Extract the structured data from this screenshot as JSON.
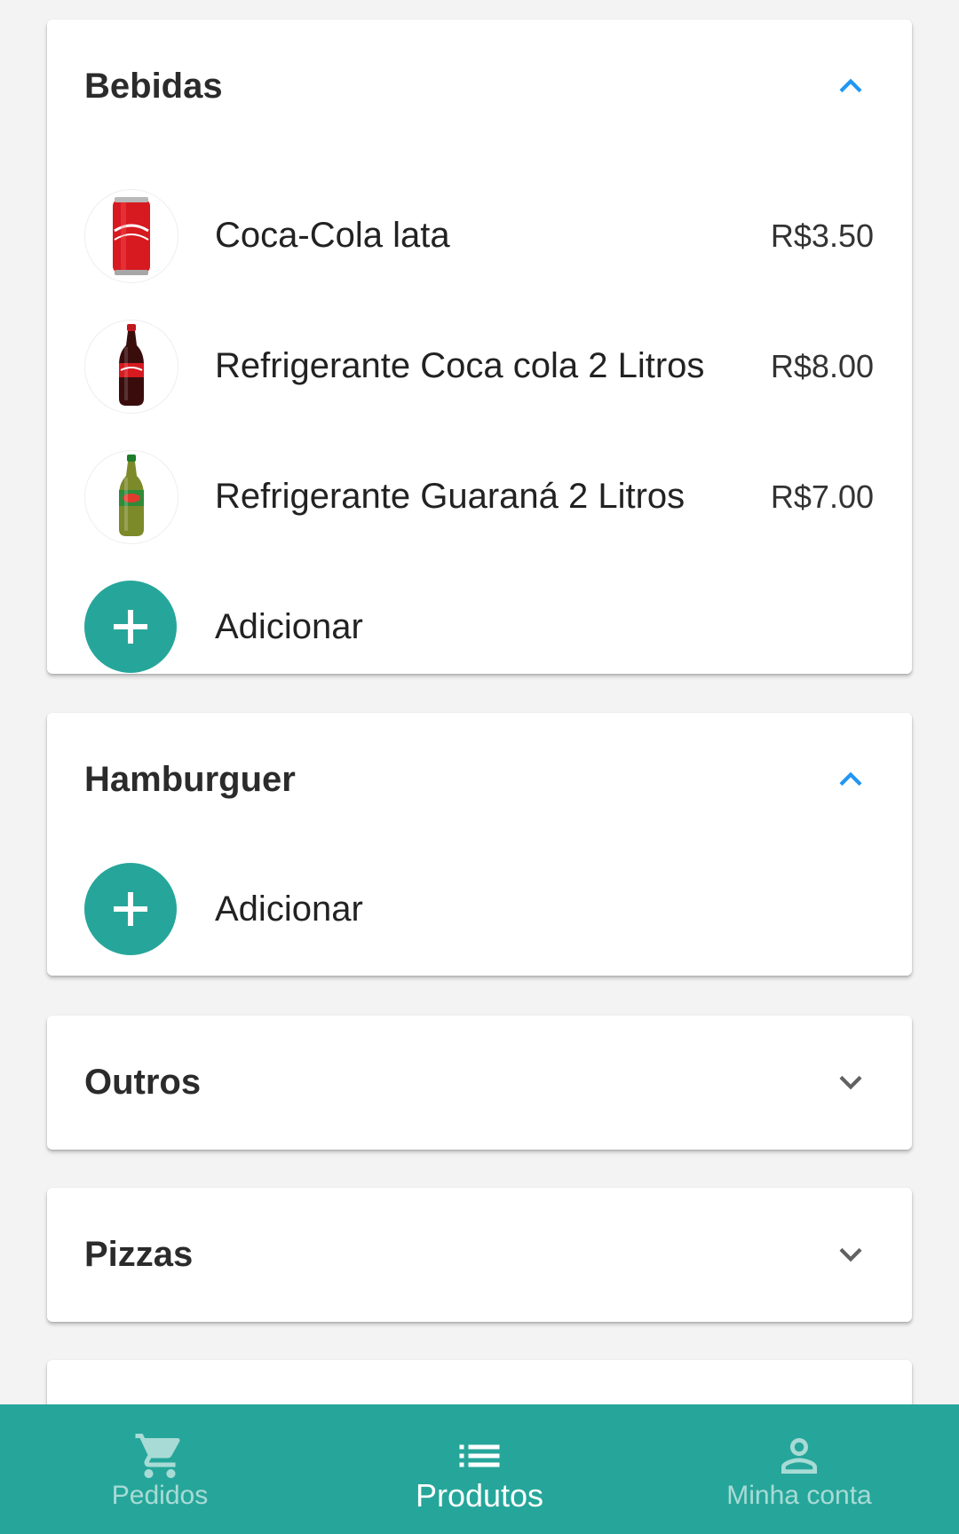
{
  "colors": {
    "accent": "#26a69a",
    "chevron_expanded": "#2196f3",
    "chevron_collapsed": "#616161",
    "background": "#f3f3f3"
  },
  "categories": [
    {
      "title": "Bebidas",
      "expanded": true,
      "chevron": "chevron-up-icon",
      "products": [
        {
          "name": "Coca-Cola lata",
          "price": "R$3.50",
          "image": "coca-cola-can"
        },
        {
          "name": "Refrigerante Coca cola 2 Litros",
          "price": "R$8.00",
          "image": "coca-cola-bottle"
        },
        {
          "name": "Refrigerante Guaraná 2 Litros",
          "price": "R$7.00",
          "image": "guarana-bottle"
        }
      ],
      "add_label": "Adicionar"
    },
    {
      "title": "Hamburguer",
      "expanded": true,
      "chevron": "chevron-up-icon",
      "products": [],
      "add_label": "Adicionar"
    },
    {
      "title": "Outros",
      "expanded": false,
      "chevron": "chevron-down-icon"
    },
    {
      "title": "Pizzas",
      "expanded": false,
      "chevron": "chevron-down-icon"
    }
  ],
  "bottom_nav": {
    "items": [
      {
        "label": "Pedidos",
        "icon": "cart-icon",
        "active": false
      },
      {
        "label": "Produtos",
        "icon": "list-icon",
        "active": true
      },
      {
        "label": "Minha conta",
        "icon": "account-icon",
        "active": false
      }
    ]
  }
}
